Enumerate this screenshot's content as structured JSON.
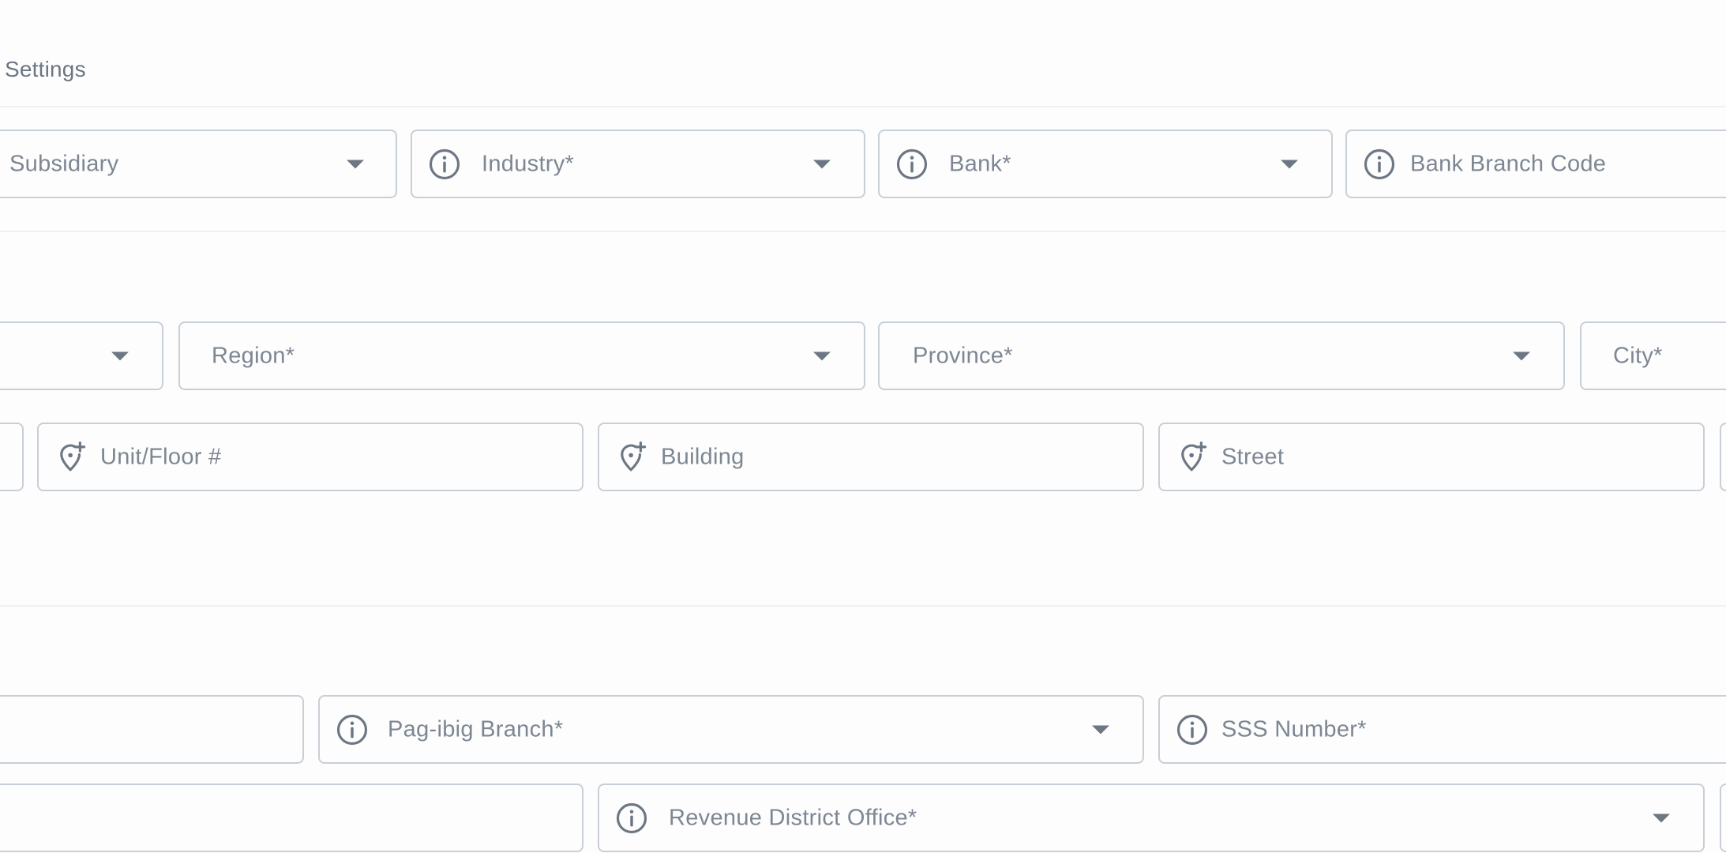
{
  "section": {
    "title": "Settings"
  },
  "fields": {
    "subsidiary": "Subsidiary",
    "industry": "Industry*",
    "bank": "Bank*",
    "bank_branch_code": "Bank Branch Code",
    "region": "Region*",
    "province": "Province*",
    "city": "City*",
    "unit_floor": "Unit/Floor #",
    "building": "Building",
    "street": "Street",
    "pagibig_branch": "Pag-ibig Branch*",
    "sss_number": "SSS Number*",
    "revenue_district_office": "Revenue District Office*"
  },
  "icons": {
    "info": "info-circle-icon",
    "location": "location-pin-plus-icon",
    "dropdown": "caret-down-icon"
  },
  "colors": {
    "border": "#c9cfd7",
    "text": "#7d8693",
    "icon": "#6d7783",
    "divider": "#eef0f3"
  }
}
